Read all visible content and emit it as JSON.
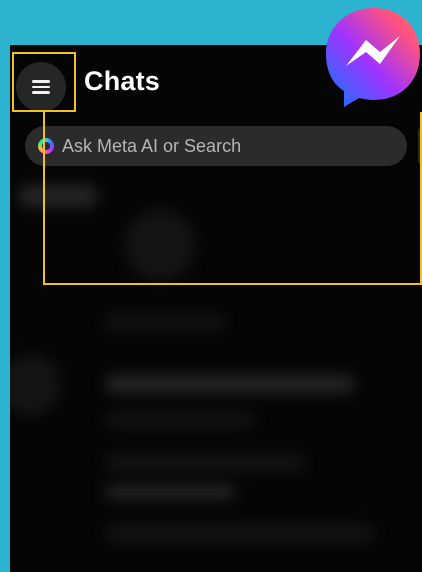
{
  "header": {
    "title": "Chats",
    "menu_icon": "hamburger-menu-icon"
  },
  "search": {
    "placeholder": "Ask Meta AI or Search",
    "icon": "meta-ai-ring-icon"
  },
  "overlay": {
    "logo": "messenger-logo",
    "highlight_color": "#f2c21b",
    "background_color": "#2bb3cf"
  }
}
